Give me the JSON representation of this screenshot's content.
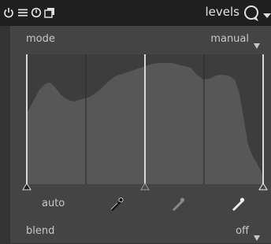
{
  "header": {
    "title": "levels",
    "icons": [
      "power-icon",
      "multi-instance-icon",
      "reset-icon",
      "copy-icon",
      "presets-icon",
      "chevron-down-icon"
    ]
  },
  "mode": {
    "label": "mode",
    "value": "manual"
  },
  "levels": {
    "black": 0.0,
    "gray": 0.5,
    "white": 1.0
  },
  "buttons": {
    "auto_label": "auto",
    "pickers": [
      "pick-black-icon",
      "pick-gray-icon",
      "pick-white-icon"
    ]
  },
  "blend": {
    "label": "blend",
    "value": "off"
  },
  "colors": {
    "background": "#333333",
    "header": "#1f1f1f",
    "panel": "#444444",
    "graph_bg": "#3d3d3d",
    "histogram": "#575757",
    "handle_line": "#d9d9d9"
  }
}
